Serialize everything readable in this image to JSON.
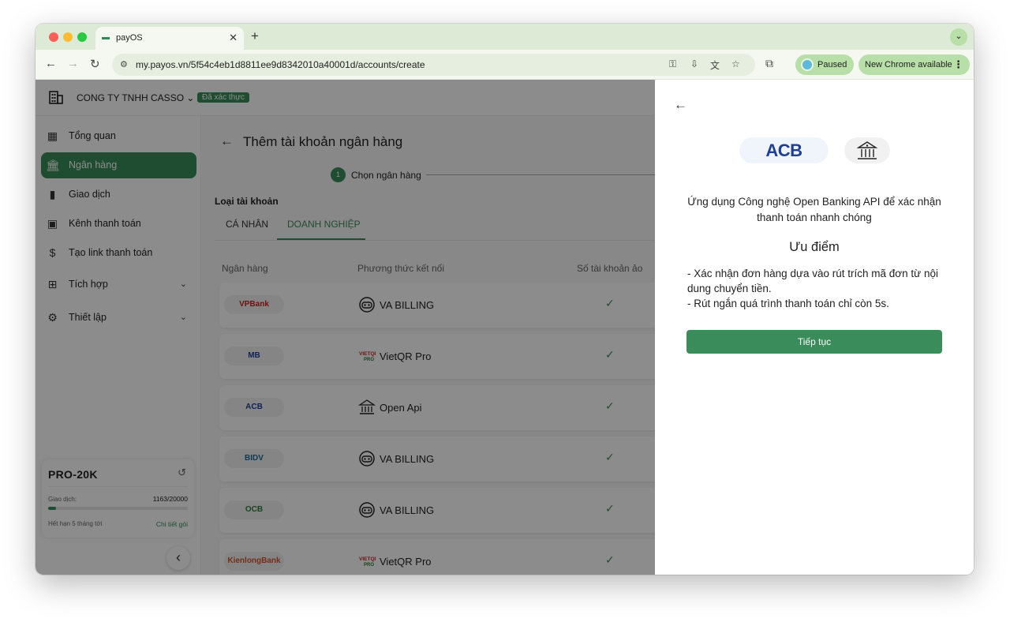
{
  "browser": {
    "tab_title": "payOS",
    "url": "my.payos.vn/5f54c4eb1d8811ee9d8342010a40001d/accounts/create",
    "profile_status": "Paused",
    "update_label": "New Chrome available"
  },
  "topbar": {
    "company": "CONG TY TNHH CASSO",
    "verified_badge": "Đã xác thực"
  },
  "sidebar": {
    "items": [
      {
        "label": "Tổng quan",
        "icon": "dashboard-icon"
      },
      {
        "label": "Ngân hàng",
        "icon": "bank-icon"
      },
      {
        "label": "Giao dịch",
        "icon": "bar-chart-icon"
      },
      {
        "label": "Kênh thanh toán",
        "icon": "wallet-icon"
      },
      {
        "label": "Tạo link thanh toán",
        "icon": "invoice-icon"
      },
      {
        "label": "Tích hợp",
        "icon": "integration-icon"
      },
      {
        "label": "Thiết lập",
        "icon": "gear-icon"
      }
    ],
    "active_index": 1,
    "plan": {
      "name": "PRO-20K",
      "tx_label": "Giao dịch:",
      "tx_value": "1163/20000",
      "tx_used": 1163,
      "tx_total": 20000,
      "expiry": "Hết hạn 5 tháng tới",
      "detail_link": "Chi tiết gói"
    }
  },
  "main": {
    "title": "Thêm tài khoản ngân hàng",
    "step_number": "1",
    "step_label": "Chọn ngân hàng",
    "account_type_label": "Loại tài khoản",
    "tab_personal": "CÁ NHÂN",
    "tab_business": "DOANH NGHIỆP",
    "table_headers": [
      "Ngân hàng",
      "Phương thức kết nối",
      "Số tài khoản ảo"
    ],
    "rows": [
      {
        "bank": "VPBank",
        "bank_color": "#d71920",
        "method": "VA BILLING",
        "method_icon": "robot-icon"
      },
      {
        "bank": "MB",
        "bank_color": "#1a3fa0",
        "method": "VietQR Pro",
        "method_icon": "vietqr-icon"
      },
      {
        "bank": "ACB",
        "bank_color": "#1f3f95",
        "method": "Open Api",
        "method_icon": "bank-building-icon"
      },
      {
        "bank": "BIDV",
        "bank_color": "#1a6b9e",
        "method": "VA BILLING",
        "method_icon": "robot-icon"
      },
      {
        "bank": "OCB",
        "bank_color": "#2c7a3c",
        "method": "VA BILLING",
        "method_icon": "robot-icon"
      },
      {
        "bank": "KienlongBank",
        "bank_color": "#d2552a",
        "method": "VietQR Pro",
        "method_icon": "vietqr-icon"
      }
    ]
  },
  "panel": {
    "bank_logo": "ACB",
    "description": "Ứng dụng Công nghệ Open Banking API để xác nhận thanh toán nhanh chóng",
    "heading": "Ưu điểm",
    "points": [
      "- Xác nhận đơn hàng dựa vào rút trích mã đơn từ nội dung chuyển tiền.",
      "- Rút ngắn quá trình thanh toán chỉ còn 5s."
    ],
    "continue_label": "Tiếp tục"
  },
  "colors": {
    "brand": "#3a8d5a",
    "browser_frame": "#dcead6",
    "overlay": "#000000"
  }
}
